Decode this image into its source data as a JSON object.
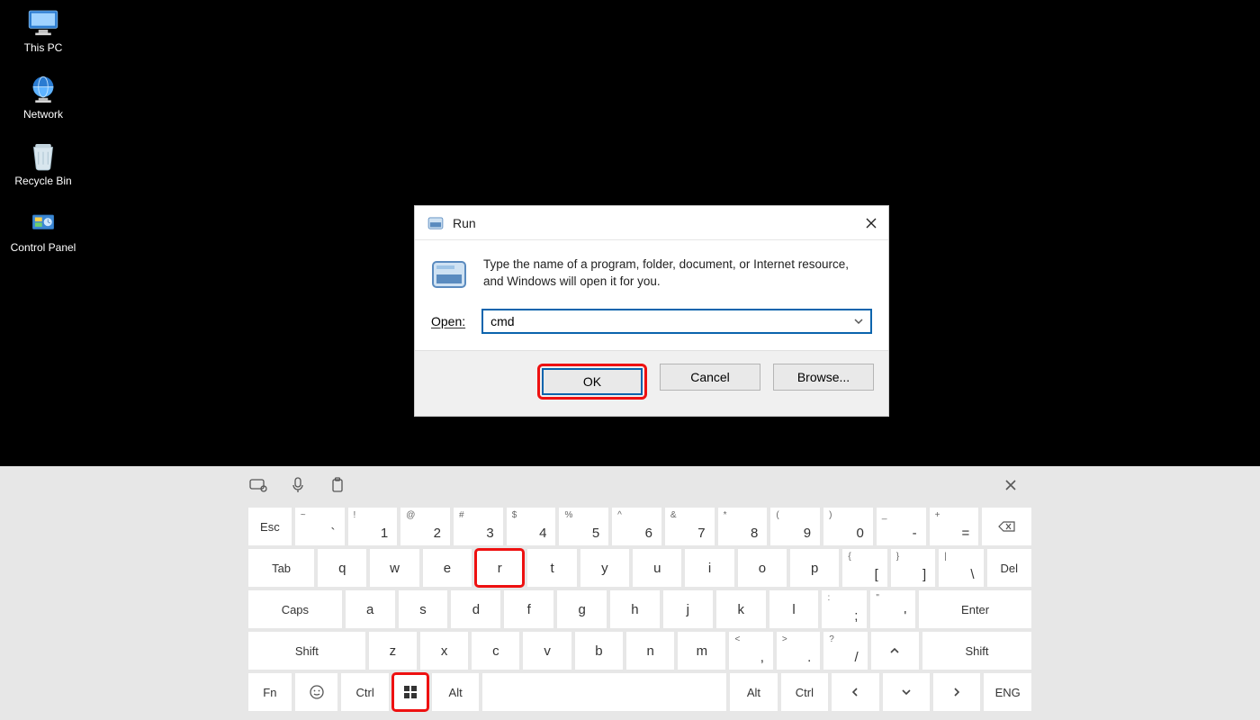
{
  "desktop": {
    "icons": [
      {
        "label": "This PC"
      },
      {
        "label": "Network"
      },
      {
        "label": "Recycle Bin"
      },
      {
        "label": "Control Panel"
      }
    ]
  },
  "run_dialog": {
    "title": "Run",
    "description": "Type the name of a program, folder, document, or Internet resource, and Windows will open it for you.",
    "open_label": "Open:",
    "open_value": "cmd",
    "buttons": {
      "ok": "OK",
      "cancel": "Cancel",
      "browse": "Browse..."
    }
  },
  "osk": {
    "row1": {
      "esc": "Esc",
      "keys": [
        {
          "sup": "~",
          "main": "`"
        },
        {
          "sup": "!",
          "main": "1"
        },
        {
          "sup": "@",
          "main": "2"
        },
        {
          "sup": "#",
          "main": "3"
        },
        {
          "sup": "$",
          "main": "4"
        },
        {
          "sup": "%",
          "main": "5"
        },
        {
          "sup": "^",
          "main": "6"
        },
        {
          "sup": "&",
          "main": "7"
        },
        {
          "sup": "*",
          "main": "8"
        },
        {
          "sup": "(",
          "main": "9"
        },
        {
          "sup": ")",
          "main": "0"
        },
        {
          "sup": "_",
          "main": "-"
        },
        {
          "sup": "+",
          "main": "="
        }
      ]
    },
    "row2": {
      "tab": "Tab",
      "letters": [
        "q",
        "w",
        "e",
        "r",
        "t",
        "y",
        "u",
        "i",
        "o",
        "p"
      ],
      "brackets": [
        {
          "sup": "{",
          "main": "["
        },
        {
          "sup": "}",
          "main": "]"
        },
        {
          "sup": "|",
          "main": "\\"
        }
      ],
      "del": "Del"
    },
    "row3": {
      "caps": "Caps",
      "letters": [
        "a",
        "s",
        "d",
        "f",
        "g",
        "h",
        "j",
        "k",
        "l"
      ],
      "punct": [
        {
          "sup": ":",
          "main": ";"
        },
        {
          "sup": "\"",
          "main": "'"
        }
      ],
      "enter": "Enter"
    },
    "row4": {
      "shiftL": "Shift",
      "letters": [
        "z",
        "x",
        "c",
        "v",
        "b",
        "n",
        "m"
      ],
      "punct": [
        {
          "sup": "<",
          "main": ","
        },
        {
          "sup": ">",
          "main": "."
        },
        {
          "sup": "?",
          "main": "/"
        }
      ],
      "shiftR": "Shift"
    },
    "row5": {
      "fn": "Fn",
      "ctrlL": "Ctrl",
      "altL": "Alt",
      "altR": "Alt",
      "ctrlR": "Ctrl",
      "lang": "ENG"
    }
  }
}
